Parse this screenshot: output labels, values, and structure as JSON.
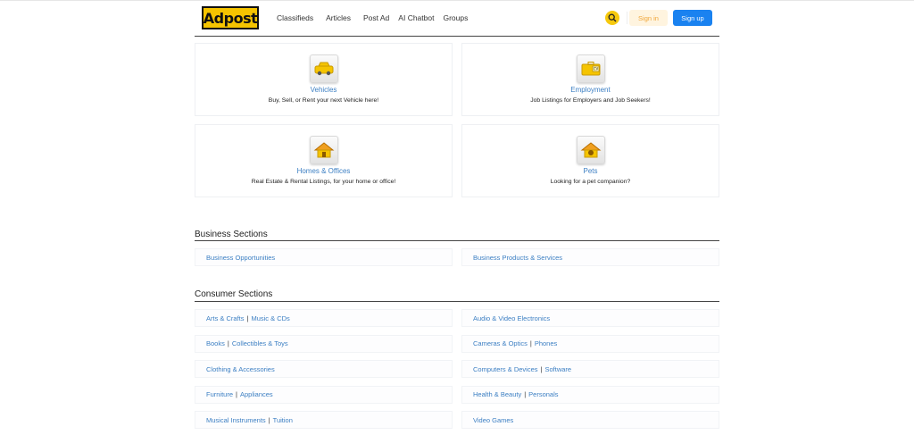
{
  "header": {
    "logo_text": "Adpost",
    "nav": [
      "Classifieds",
      "Articles",
      "Post Ad",
      "AI Chatbot",
      "Groups"
    ],
    "signin_label": "Sign in",
    "signup_label": "Sign up"
  },
  "categories": [
    {
      "title": "Vehicles",
      "desc": "Buy, Sell, or Rent your next Vehicle here!",
      "icon": "car-icon"
    },
    {
      "title": "Employment",
      "desc": "Job Listings for Employers and Job Seekers!",
      "icon": "briefcase-cv-icon"
    },
    {
      "title": "Homes & Offices",
      "desc": "Real Estate & Rental Listings, for your home or office!",
      "icon": "house-icon"
    },
    {
      "title": "Pets",
      "desc": "Looking for a pet companion?",
      "icon": "pets-icon"
    }
  ],
  "business": {
    "title": "Business Sections",
    "links": [
      {
        "parts": [
          "Business Opportunities"
        ]
      },
      {
        "parts": [
          "Business Products & Services"
        ]
      }
    ]
  },
  "consumer": {
    "title": "Consumer Sections",
    "links": [
      {
        "parts": [
          "Arts & Crafts",
          "Music & CDs"
        ]
      },
      {
        "parts": [
          "Audio & Video Electronics"
        ]
      },
      {
        "parts": [
          "Books",
          "Collectibles & Toys"
        ]
      },
      {
        "parts": [
          "Cameras & Optics",
          "Phones"
        ]
      },
      {
        "parts": [
          "Clothing & Accessories"
        ]
      },
      {
        "parts": [
          "Computers & Devices",
          "Software"
        ]
      },
      {
        "parts": [
          "Furniture",
          "Appliances"
        ]
      },
      {
        "parts": [
          "Health & Beauty",
          "Personals"
        ]
      },
      {
        "parts": [
          "Musical Instruments",
          "Tuition"
        ]
      },
      {
        "parts": [
          "Video Games"
        ]
      }
    ]
  },
  "colors": {
    "accent": "#f5c400",
    "link": "#3c7fc3",
    "signup_bg": "#1a82f0",
    "signin_text": "#f0a63a"
  }
}
